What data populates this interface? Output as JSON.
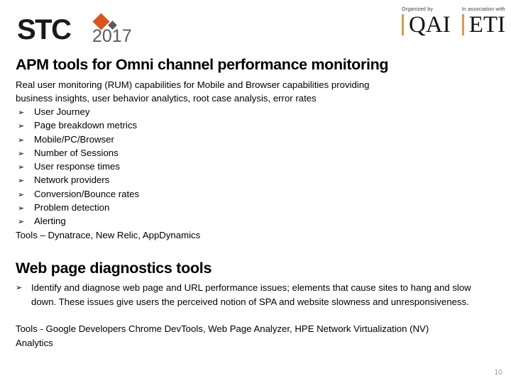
{
  "header": {
    "brand": {
      "name": "STC",
      "year": "2017",
      "diamond_color": "#d9551f",
      "accent_gray": "#5b5b5b"
    },
    "partners": [
      {
        "caption": "Organized by",
        "name": "QAI",
        "rule_color": "#d89a4e"
      },
      {
        "caption": "In association with",
        "name": "ETI",
        "rule_color": "#d89a4e"
      }
    ]
  },
  "slide": {
    "title": "APM tools for Omni channel performance monitoring",
    "intro_line_1": "Real user monitoring (RUM) capabilities for Mobile and Browser capabilities providing",
    "intro_line_2": "business insights, user behavior analytics, root case analysis, error rates",
    "bullet_glyph": "➢",
    "bullets": [
      {
        "label": "User Journey"
      },
      {
        "label": "Page breakdown metrics"
      },
      {
        "label": "Mobile/PC/Browser"
      },
      {
        "label": "Number of Sessions"
      },
      {
        "label": "User response times"
      },
      {
        "label": "Network providers"
      },
      {
        "label": "Conversion/Bounce rates"
      },
      {
        "label": "Problem detection"
      },
      {
        "label": "Alerting"
      }
    ],
    "tools_line_1": "Tools – Dynatrace, New Relic, AppDynamics",
    "section_title": "Web page diagnostics tools",
    "diagnostics_bullet": "Identify and diagnose web page and URL performance issues; elements that cause sites to hang and slow down. These issues give users the perceived notion of SPA and website slowness and unresponsiveness.",
    "tools_line_2": "Tools - Google Developers Chrome DevTools, Web Page Analyzer, HPE Network Virtualization (NV) Analytics",
    "page_number": "10"
  }
}
